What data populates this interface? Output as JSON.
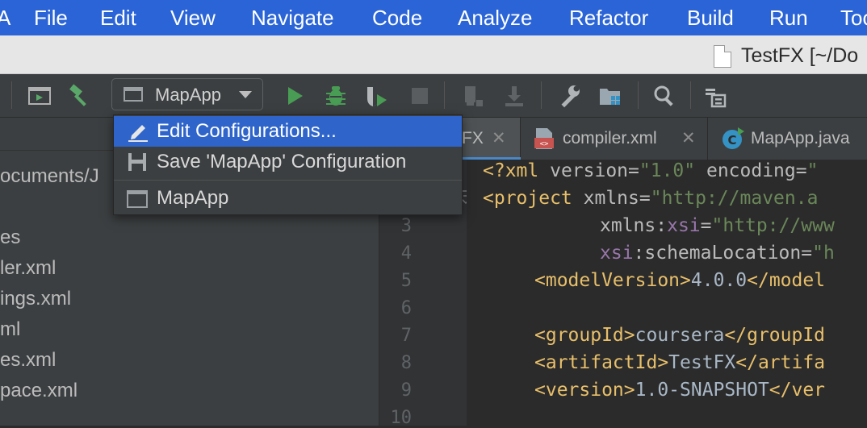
{
  "menubar": {
    "app_fragment": "A",
    "items": [
      "File",
      "Edit",
      "View",
      "Navigate",
      "Code",
      "Analyze",
      "Refactor",
      "Build",
      "Run",
      "Too"
    ]
  },
  "window": {
    "title": "TestFX [~/Do"
  },
  "toolbar": {
    "run_config_label": "MapApp",
    "icons": [
      "project-structure-icon",
      "build-hammer-icon",
      "run-icon",
      "debug-icon",
      "run-with-coverage-icon",
      "stop-icon",
      "vcs-update-icon",
      "vcs-commit-icon",
      "settings-wrench-icon",
      "project-structure-folder-icon",
      "search-icon",
      "sdk-icon"
    ]
  },
  "dropdown": {
    "items": [
      {
        "label": "Edit Configurations...",
        "selected": true,
        "icon": "pencil-icon"
      },
      {
        "label": "Save 'MapApp' Configuration",
        "selected": false,
        "icon": "save-icon"
      },
      {
        "label": "MapApp",
        "selected": false,
        "icon": "application-config-icon"
      }
    ]
  },
  "project_panel": {
    "path_fragment": "ocuments/J",
    "rows": [
      "es",
      "ler.xml",
      "ings.xml",
      "ml",
      "es.xml",
      "pace.xml"
    ]
  },
  "tabs": [
    {
      "label": "FX",
      "close": "✕",
      "active": true
    },
    {
      "label": "compiler.xml",
      "close": "✕",
      "icon": "xml-file-icon"
    },
    {
      "label": "MapApp.java",
      "icon": "java-class-icon"
    }
  ],
  "editor": {
    "line_numbers": [
      "3",
      "4",
      "5",
      "6",
      "7",
      "8",
      "9",
      "10"
    ],
    "lines": {
      "l1_open": "<?xml",
      "l1_attr1": " version=",
      "l1_val1": "\"1.0\"",
      "l1_attr2": " encoding=",
      "l1_val2": "\"",
      "l2_open": "<project",
      "l2_attr": " xmlns=",
      "l2_val": "\"http://maven.a",
      "l3_ns": "xmlns:xsi",
      "l3_eq": "=",
      "l3_val": "\"http://www",
      "l4_ns": "xsi",
      "l4_attr": ":schemaLocation=",
      "l4_val": "\"h",
      "l5_open": "<modelVersion>",
      "l5_text": "4.0.0",
      "l5_close": "</model",
      "l7_open": "<groupId>",
      "l7_text": "coursera",
      "l7_close": "</groupId",
      "l8_open": "<artifactId>",
      "l8_text": "TestFX",
      "l8_close": "</artifa",
      "l9_open": "<version>",
      "l9_text": "1.0-SNAPSHOT",
      "l9_close": "</ver"
    }
  }
}
